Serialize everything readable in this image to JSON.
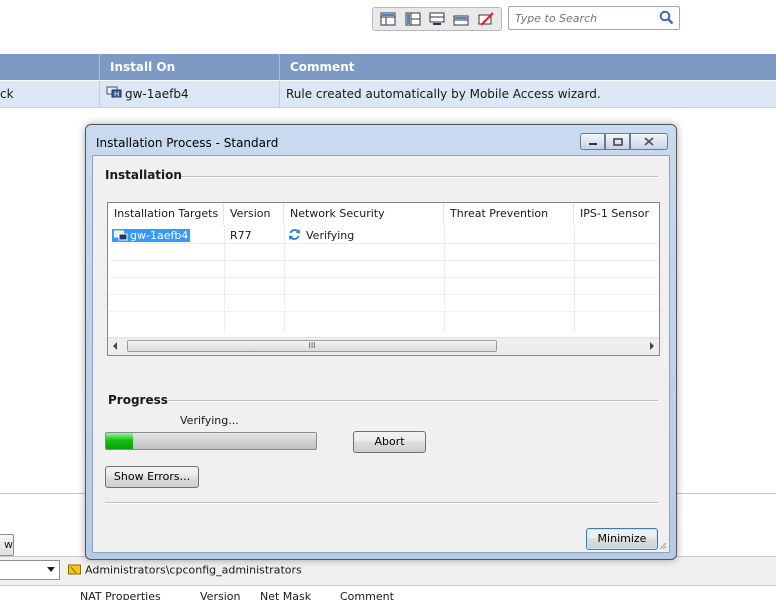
{
  "search": {
    "placeholder": "Type to Search"
  },
  "grid": {
    "columns": [
      "Install On",
      "Comment"
    ],
    "row": {
      "first_cell": "ck",
      "install_on": "gw-1aefb4",
      "comment": "Rule created automatically by Mobile Access wizard."
    }
  },
  "bottom": {
    "button_label": "w",
    "path": "Administrators\\cpconfig_administrators",
    "headers": [
      "NAT Properties",
      "Version",
      "Net Mask",
      "Comment"
    ]
  },
  "dialog": {
    "title": "Installation Process  - Standard",
    "installation_label": "Installation",
    "columns": [
      "Installation Targets",
      "Version",
      "Network Security",
      "Threat Prevention",
      "IPS-1 Sensor"
    ],
    "rows": [
      {
        "target": "gw-1aefb4",
        "version": "R77",
        "network_security": "Verifying",
        "threat_prevention": "",
        "ips1_sensor": ""
      }
    ],
    "scroll_thumb_label": "III",
    "progress_label": "Progress",
    "progress_status": "Verifying...",
    "progress_fraction": 0.13,
    "abort_label": "Abort",
    "show_errors_label": "Show Errors...",
    "minimize_label": "Minimize"
  },
  "colors": {
    "header_bg": "#7d9ac5",
    "row_selected": "#dce6f4",
    "progress_fill": "#11c311",
    "selection": "#3399ff"
  }
}
